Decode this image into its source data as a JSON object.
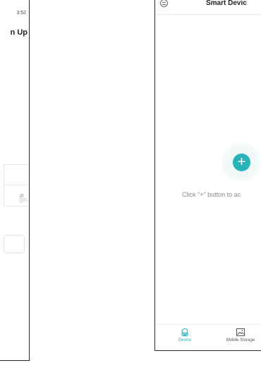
{
  "left_screen": {
    "status_time": "3:52",
    "title": "n Up",
    "login_link": "gin",
    "eye_icon": "eye-off-icon"
  },
  "right_screen": {
    "menu_icon": "menu-circle-icon",
    "title": "Smart Devic",
    "add_button_label": "+",
    "empty_hint": "Click \"+\" button to ac",
    "accent_color": "#27b3b9",
    "bottom_nav": {
      "items": [
        {
          "label": "Device",
          "icon": "device-icon",
          "active": true
        },
        {
          "label": "Mobile Storage",
          "icon": "image-icon",
          "active": false
        }
      ]
    }
  }
}
